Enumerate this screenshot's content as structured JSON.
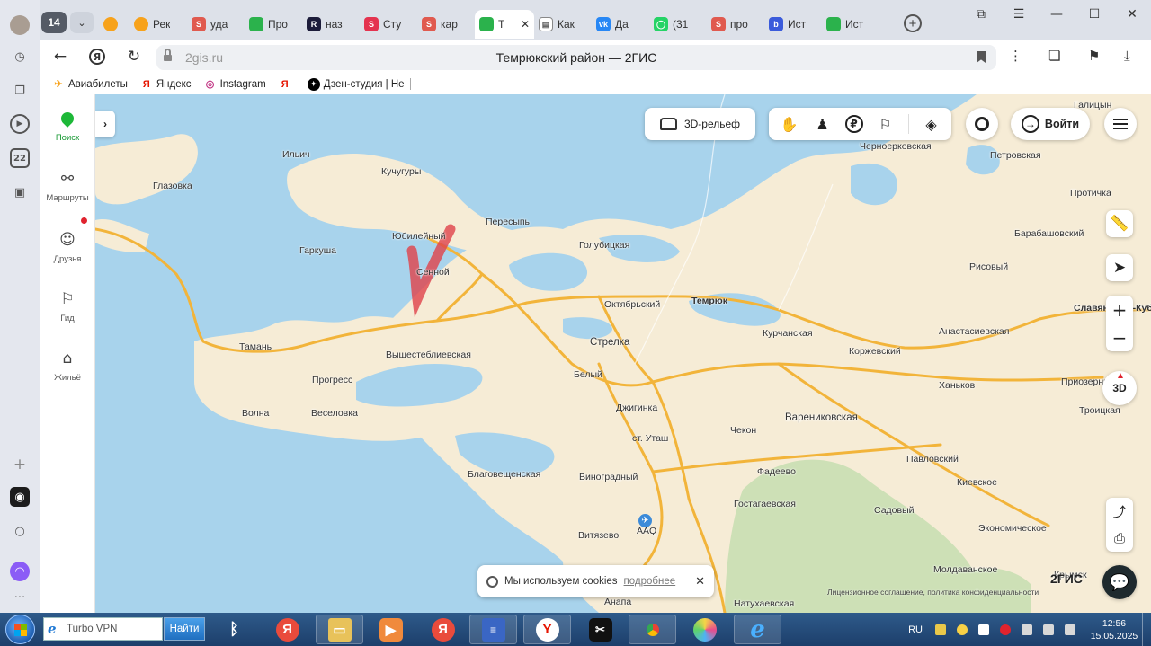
{
  "window": {
    "tab_count": "14",
    "tabs": [
      {
        "label": "",
        "favicon_color": "#f7a21b",
        "icon": "circle-favicon"
      },
      {
        "label": "Рек",
        "favicon_color": "#f7a21b",
        "icon": "circle-favicon"
      },
      {
        "label": "уда",
        "favicon_color": "#e05a4f",
        "icon": "s-favicon"
      },
      {
        "label": "Про",
        "favicon_color": "#2bb24c",
        "icon": "g-favicon"
      },
      {
        "label": "наз",
        "favicon_color": "#1c1c3a",
        "icon": "r-favicon"
      },
      {
        "label": "Сту",
        "favicon_color": "#e4334f",
        "icon": "s-favicon"
      },
      {
        "label": "кар",
        "favicon_color": "#e05a4f",
        "icon": "s-favicon"
      },
      {
        "label": "Т",
        "favicon_color": "#2bb24c",
        "icon": "2gis-favicon",
        "active": true
      },
      {
        "label": "Как",
        "favicon_color": "#ffffff",
        "icon": "doc-favicon"
      },
      {
        "label": "Да",
        "favicon_color": "#2787f5",
        "icon": "vk-favicon"
      },
      {
        "label": "(31",
        "favicon_color": "#25d366",
        "icon": "whatsapp-favicon"
      },
      {
        "label": "про",
        "favicon_color": "#e05a4f",
        "icon": "s-favicon"
      },
      {
        "label": "Ист",
        "favicon_color": "#3b5bdb",
        "icon": "b-favicon"
      },
      {
        "label": "Ист",
        "favicon_color": "#2bb24c",
        "icon": "g-favicon"
      }
    ],
    "active_close": "✕"
  },
  "address": {
    "url": "2gis.ru",
    "title": "Темрюкский район — 2ГИС"
  },
  "bookmarks": [
    {
      "label": "Авиабилеты",
      "icon": "plane-icon",
      "color": "#f7a21b"
    },
    {
      "label": "Яндекс",
      "icon": "yandex-icon",
      "color": "#e61400"
    },
    {
      "label": "Instagram",
      "icon": "instagram-icon",
      "color": "#c13584"
    },
    {
      "label": "",
      "icon": "yandex-icon",
      "color": "#e61400"
    },
    {
      "label": "Дзен-студия | Не",
      "icon": "dzen-icon",
      "color": "#000000"
    }
  ],
  "gis_sidebar": [
    {
      "label": "Поиск",
      "icon": "search-leaf-icon",
      "active": true
    },
    {
      "label": "Маршруты",
      "icon": "routes-icon"
    },
    {
      "label": "Друзья",
      "icon": "friends-icon"
    },
    {
      "label": "Гид",
      "icon": "flag-icon"
    },
    {
      "label": "Жильё",
      "icon": "housing-icon"
    }
  ],
  "map_controls": {
    "relief": "3D-рельеф",
    "login": "Войти",
    "btn_3d": "3D",
    "logo": "2ГИС",
    "legal": "Лицензионное соглашение, политика конфиденциальности",
    "cookie_text": "Мы используем cookies",
    "cookie_link": "подробнее"
  },
  "map_labels": [
    {
      "text": "Ильич"
    },
    {
      "text": "Кучугуры"
    },
    {
      "text": "Черноерковская"
    },
    {
      "text": "Петровская"
    },
    {
      "text": "Голубицкая"
    },
    {
      "text": "Пересыпь"
    },
    {
      "text": "Юбилейный"
    },
    {
      "text": "Гаркуша"
    },
    {
      "text": "Сенной"
    },
    {
      "text": "Глазовка"
    },
    {
      "text": "Темрюк"
    },
    {
      "text": "Октябрьский"
    },
    {
      "text": "Тамань"
    },
    {
      "text": "Стрелка"
    },
    {
      "text": "Курчанская"
    },
    {
      "text": "Коржевский"
    },
    {
      "text": "Анастасиевская"
    },
    {
      "text": "Вышестеблиевская"
    },
    {
      "text": "Белый"
    },
    {
      "text": "Прогресс"
    },
    {
      "text": "Ханьков"
    },
    {
      "text": "Приозерный"
    },
    {
      "text": "Троицкая"
    },
    {
      "text": "Волна"
    },
    {
      "text": "Веселовка"
    },
    {
      "text": "Джигинка"
    },
    {
      "text": "Варениковская"
    },
    {
      "text": "ст. Уташ"
    },
    {
      "text": "Чекон"
    },
    {
      "text": "Павловский"
    },
    {
      "text": "Благовещенская"
    },
    {
      "text": "Виноградный"
    },
    {
      "text": "Фадеево"
    },
    {
      "text": "Киевское"
    },
    {
      "text": "Гостагаевская"
    },
    {
      "text": "Садовый"
    },
    {
      "text": "AAQ"
    },
    {
      "text": "Витязево"
    },
    {
      "text": "Экономическое"
    },
    {
      "text": "Молдаванское"
    },
    {
      "text": "Крымск"
    },
    {
      "text": "Анапа"
    },
    {
      "text": "Натухаевская"
    },
    {
      "text": "Рисовый"
    },
    {
      "text": "Протичка"
    },
    {
      "text": "Барабашовский"
    },
    {
      "text": "Славянск-на-Кубани"
    },
    {
      "text": "Галицын"
    }
  ],
  "taskbar": {
    "search_text": "Turbo VPN",
    "search_button": "Найти",
    "lang": "RU",
    "time": "12:56",
    "date": "15.05.2025"
  },
  "colors": {
    "water": "#a8d3ec",
    "land": "#f6ecd6",
    "road": "#f2b43a",
    "forest": "#cde0b6",
    "accent": "#1db838"
  }
}
